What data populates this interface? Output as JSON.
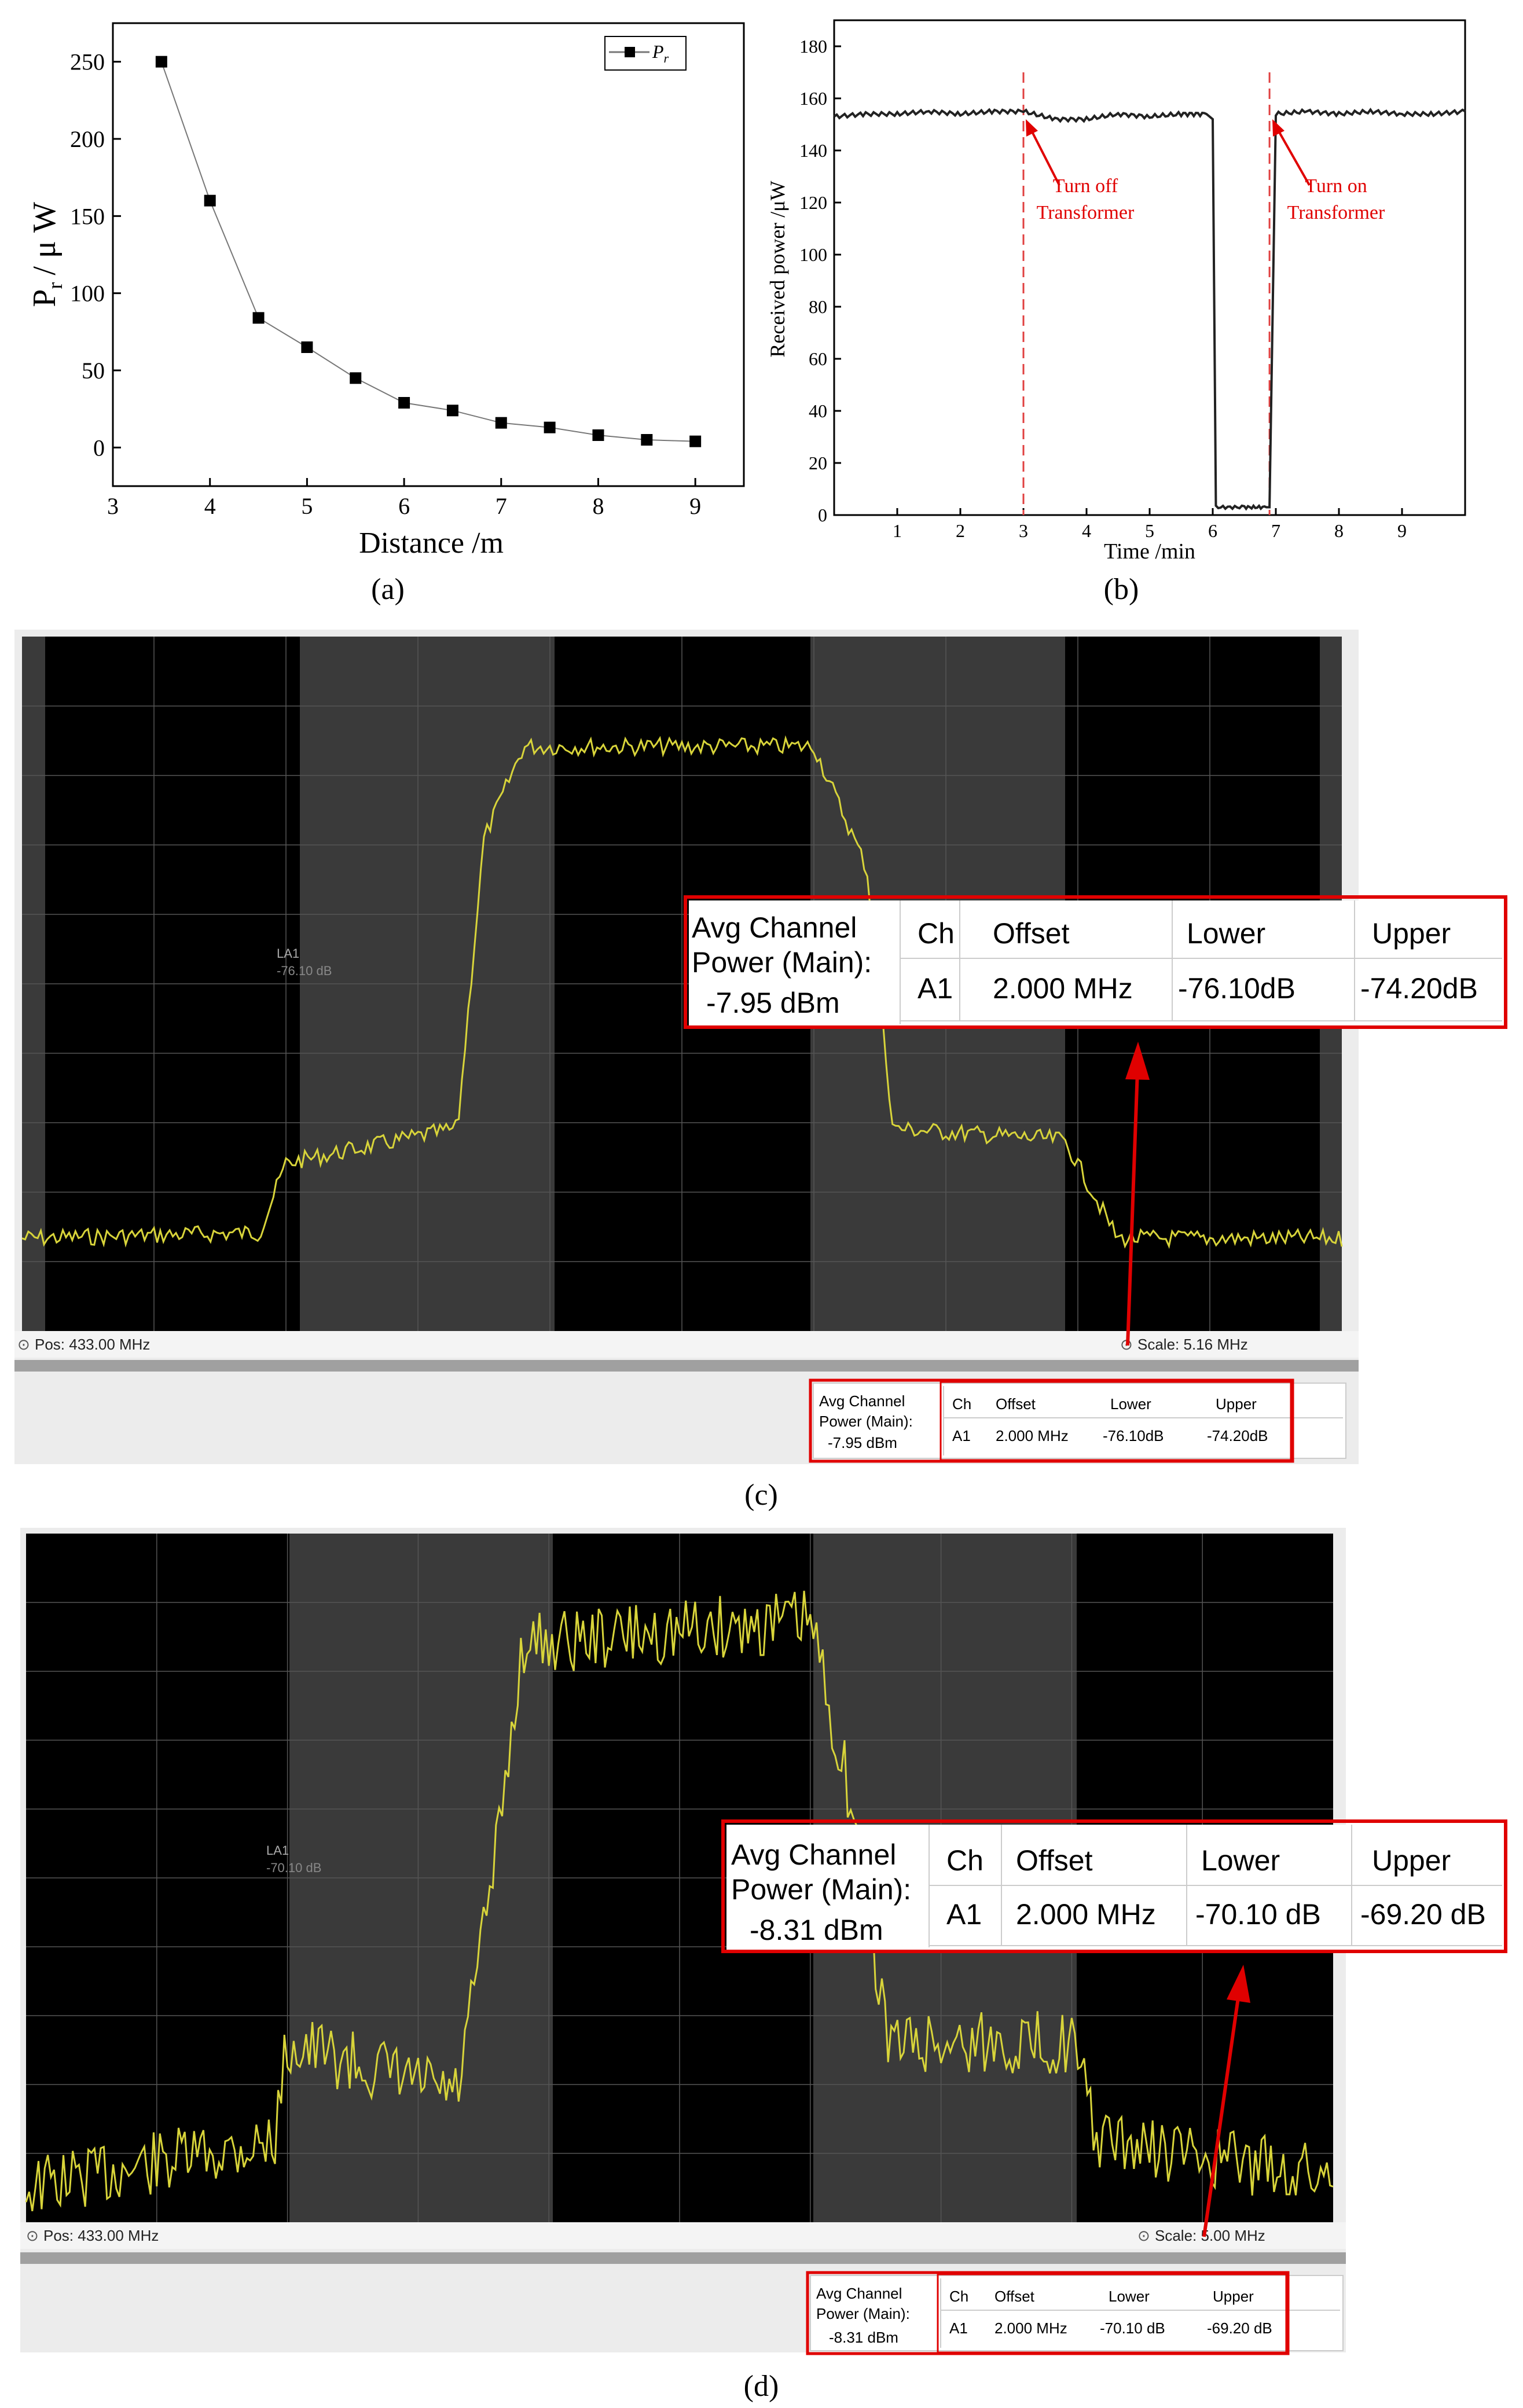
{
  "panel_labels": {
    "a": "(a)",
    "b": "(b)",
    "c": "(c)",
    "d": "(d)"
  },
  "chart_data": [
    {
      "id": "a",
      "type": "line",
      "xlabel": "Distance /m",
      "ylabel": "P_r / μ W",
      "ylabel_main": "P",
      "ylabel_sub": "r",
      "ylabel_rest": "/ μ W",
      "legend": {
        "text": "P",
        "sub": "r",
        "placement": "top-right"
      },
      "xlim": [
        3,
        9.5
      ],
      "ylim": [
        -25,
        275
      ],
      "xticks": [
        "3",
        "4",
        "5",
        "6",
        "7",
        "8",
        "9"
      ],
      "yticks": [
        "0",
        "50",
        "100",
        "150",
        "200",
        "250"
      ],
      "series": [
        {
          "name": "Pr",
          "marker": "square",
          "x": [
            3.5,
            4,
            4.5,
            5,
            5.5,
            6,
            6.5,
            7,
            7.5,
            8,
            8.5,
            9
          ],
          "y": [
            250,
            160,
            84,
            65,
            45,
            29,
            24,
            16,
            13,
            8,
            5,
            4
          ]
        }
      ]
    },
    {
      "id": "b",
      "type": "line",
      "xlabel": "Time /min",
      "ylabel": "Received power /μW",
      "xlim": [
        0,
        10
      ],
      "ylim": [
        0,
        190
      ],
      "xticks": [
        "1",
        "2",
        "3",
        "4",
        "5",
        "6",
        "7",
        "8",
        "9"
      ],
      "yticks": [
        "0",
        "20",
        "40",
        "60",
        "80",
        "100",
        "120",
        "140",
        "160",
        "180"
      ],
      "series": [
        {
          "name": "received",
          "x": [
            0,
            0.5,
            1,
            1.5,
            2,
            2.5,
            3,
            3.5,
            4,
            4.5,
            5,
            5.5,
            5.9,
            6.0,
            6.05,
            6.5,
            6.85,
            6.9,
            7.0,
            7.5,
            8,
            8.5,
            9,
            9.5,
            10
          ],
          "y": [
            153,
            154,
            154,
            155,
            154,
            155,
            155,
            152,
            152,
            154,
            153,
            154,
            154,
            152,
            3,
            3,
            3,
            3,
            154,
            155,
            154,
            155,
            154,
            154,
            155
          ]
        }
      ],
      "vlines": [
        3,
        6.9
      ],
      "annotations": [
        {
          "lines": [
            "Turn off",
            "Transformer"
          ]
        },
        {
          "lines": [
            "Turn on",
            "Transformer"
          ]
        }
      ]
    }
  ],
  "spectrum_c": {
    "marker_label": "LA1",
    "marker_value": "-76.10 dB",
    "pos": "Pos:  433.00 MHz",
    "scale": "Scale:  5.16 MHz",
    "table": {
      "title_line1": "Avg Channel",
      "title_line2": "Power (Main):",
      "value": "-7.95 dBm",
      "headers": [
        "Ch",
        "Offset",
        "Lower",
        "Upper"
      ],
      "row": [
        "A1",
        "2.000 MHz",
        "-76.10dB",
        "-74.20dB"
      ]
    }
  },
  "spectrum_d": {
    "marker_label": "LA1",
    "marker_value": "-70.10 dB",
    "pos": "Pos:  433.00 MHz",
    "scale": "Scale:  5.00 MHz",
    "table": {
      "title_line1": "Avg Channel",
      "title_line2": "Power (Main):",
      "value": "-8.31 dBm",
      "headers": [
        "Ch",
        "Offset",
        "Lower",
        "Upper"
      ],
      "row": [
        "A1",
        "2.000 MHz",
        "-70.10 dB",
        "-69.20 dB"
      ]
    }
  },
  "colors": {
    "trace": "#d8d43a",
    "highlight": "#e00000",
    "dash": "#e04040",
    "band_dark": "#000000",
    "band_gray": "#3a3a3a"
  }
}
